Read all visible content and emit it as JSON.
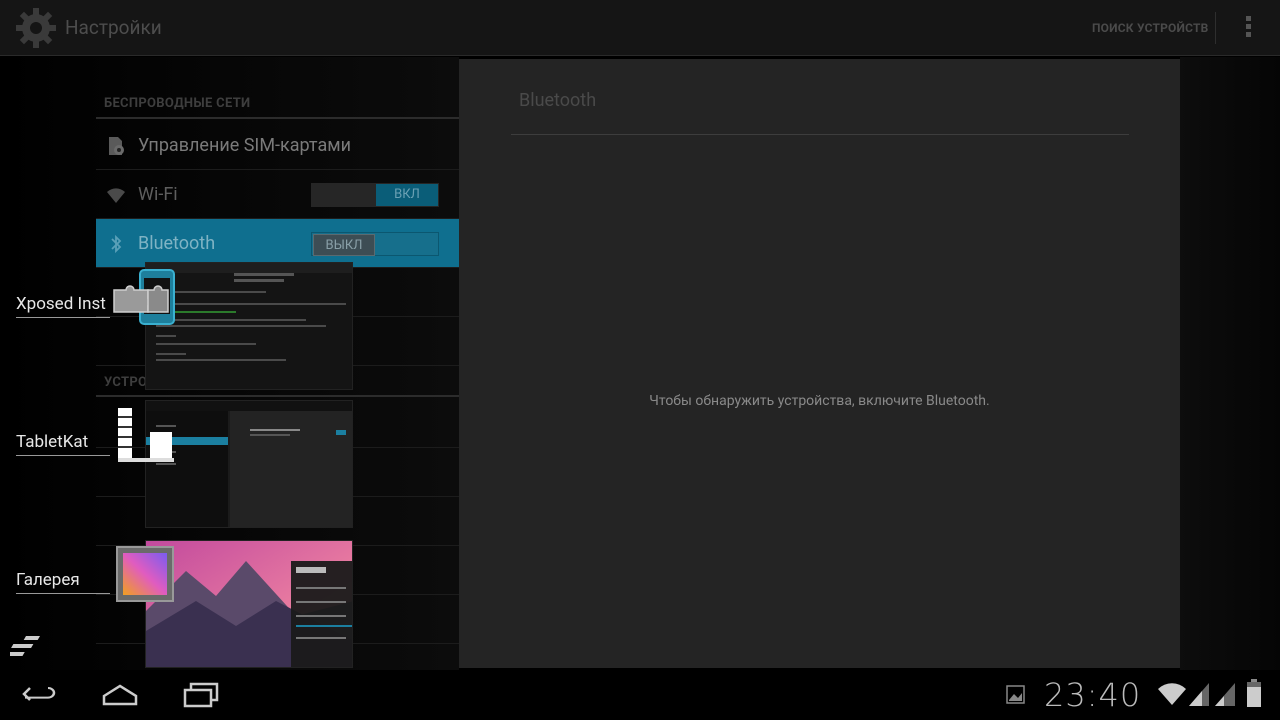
{
  "action_bar": {
    "title": "Настройки",
    "scan_button": "ПОИСК УСТРОЙСТВ"
  },
  "left_list": {
    "section_wireless": "БЕСПРОВОДНЫЕ СЕТИ",
    "section_device_partial": "УСТРО",
    "rows": {
      "sim": "Управление SIM-картами",
      "wifi": "Wi-Fi",
      "bluetooth": "Bluetooth"
    },
    "wifi_switch": "ВКЛ",
    "bt_switch": "ВЫКЛ"
  },
  "detail": {
    "title": "Bluetooth",
    "message": "Чтобы обнаружить устройства, включите Bluetooth."
  },
  "recent_apps": [
    {
      "label": "Xposed Inst",
      "icon": "xposed-puzzle-icon"
    },
    {
      "label": "TabletKat",
      "icon": "tabletkat-icon"
    },
    {
      "label": "Галерея",
      "icon": "gallery-icon"
    }
  ],
  "status": {
    "clock": "23:40"
  },
  "colors": {
    "accent": "#0f6f8f",
    "switch_on": "#0a5d78"
  }
}
